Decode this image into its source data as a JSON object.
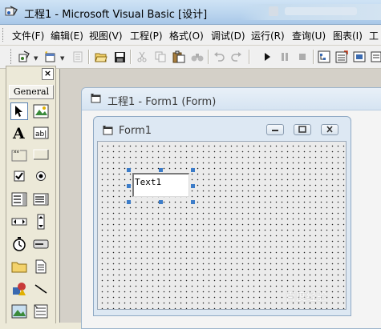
{
  "window": {
    "title": "工程1 - Microsoft Visual Basic [设计]"
  },
  "menu": [
    {
      "label": "文件(F)"
    },
    {
      "label": "编辑(E)"
    },
    {
      "label": "视图(V)"
    },
    {
      "label": "工程(P)"
    },
    {
      "label": "格式(O)"
    },
    {
      "label": "调试(D)"
    },
    {
      "label": "运行(R)"
    },
    {
      "label": "查询(U)"
    },
    {
      "label": "图表(I)"
    },
    {
      "label": "工"
    }
  ],
  "toolbox": {
    "close_label": "×",
    "tab_label": "General",
    "tools": [
      "pointer",
      "picturebox",
      "label",
      "textbox",
      "frame",
      "commandbutton",
      "checkbox",
      "optionbutton",
      "combobox",
      "listbox",
      "hscrollbar",
      "vscrollbar",
      "timer",
      "drivelistbox",
      "dirlistbox",
      "filelistbox",
      "shape",
      "line",
      "image",
      "data"
    ]
  },
  "designer": {
    "title": "工程1 - Form1 (Form)"
  },
  "form": {
    "title": "Form1",
    "textbox_text": "Text1"
  },
  "watermark": "百度经验"
}
